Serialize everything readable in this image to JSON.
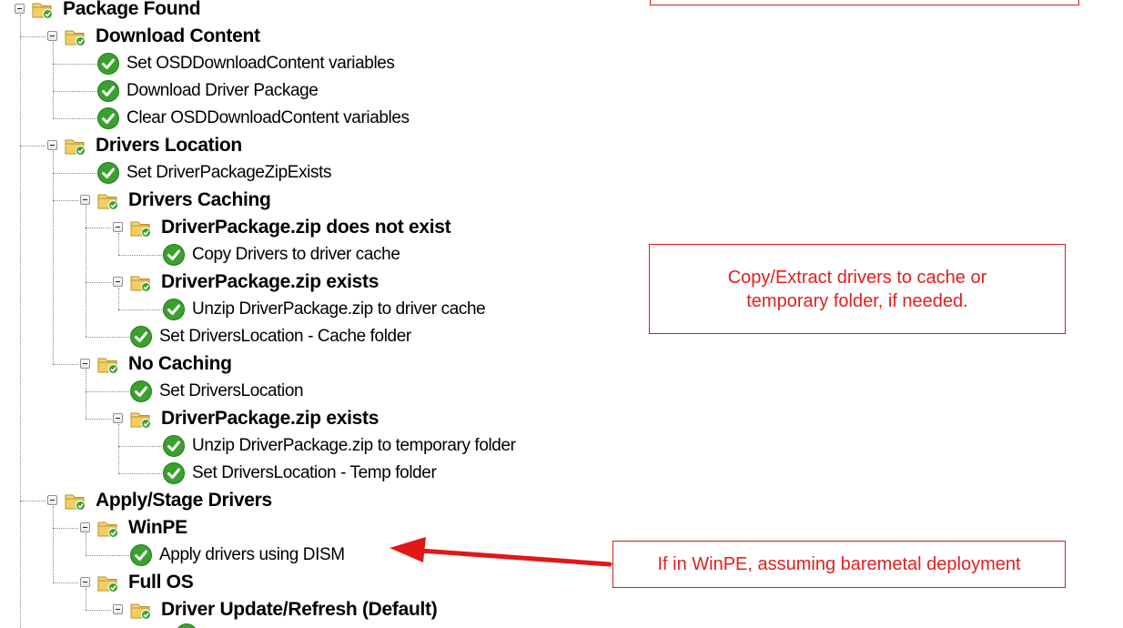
{
  "tree": {
    "nodes": [
      {
        "id": "package-found",
        "type": "group",
        "label": "Package Found"
      },
      {
        "id": "download-content",
        "type": "group",
        "label": "Download Content"
      },
      {
        "id": "set-osd-vars",
        "type": "step",
        "label": "Set OSDDownloadContent variables"
      },
      {
        "id": "download-driver-package",
        "type": "step",
        "label": "Download Driver Package"
      },
      {
        "id": "clear-osd-vars",
        "type": "step",
        "label": "Clear OSDDownloadContent variables"
      },
      {
        "id": "drivers-location",
        "type": "group",
        "label": "Drivers Location"
      },
      {
        "id": "set-zip-exists",
        "type": "step",
        "label": "Set DriverPackageZipExists"
      },
      {
        "id": "drivers-caching",
        "type": "group",
        "label": "Drivers Caching"
      },
      {
        "id": "zip-not-exist",
        "type": "group",
        "label": "DriverPackage.zip does not exist"
      },
      {
        "id": "copy-drivers-cache",
        "type": "step",
        "label": "Copy Drivers to driver cache"
      },
      {
        "id": "zip-exists-1",
        "type": "group",
        "label": "DriverPackage.zip exists"
      },
      {
        "id": "unzip-to-cache",
        "type": "step",
        "label": "Unzip DriverPackage.zip to driver cache"
      },
      {
        "id": "set-location-cache",
        "type": "step",
        "label": "Set DriversLocation - Cache folder"
      },
      {
        "id": "no-caching",
        "type": "group",
        "label": "No Caching"
      },
      {
        "id": "set-drivers-location",
        "type": "step",
        "label": "Set DriversLocation"
      },
      {
        "id": "zip-exists-2",
        "type": "group",
        "label": "DriverPackage.zip exists"
      },
      {
        "id": "unzip-to-temp",
        "type": "step",
        "label": "Unzip DriverPackage.zip to temporary folder"
      },
      {
        "id": "set-location-temp",
        "type": "step",
        "label": "Set DriversLocation - Temp folder"
      },
      {
        "id": "apply-stage-drivers",
        "type": "group",
        "label": "Apply/Stage Drivers"
      },
      {
        "id": "winpe",
        "type": "group",
        "label": "WinPE"
      },
      {
        "id": "apply-dism",
        "type": "step",
        "label": "Apply drivers using DISM"
      },
      {
        "id": "full-os",
        "type": "group",
        "label": "Full OS"
      },
      {
        "id": "driver-update-refresh",
        "type": "group",
        "label": "Driver Update/Refresh (Default)"
      }
    ]
  },
  "callouts": {
    "copy_extract": {
      "line1": "Copy/Extract drivers to cache or",
      "line2": "temporary folder, if needed."
    },
    "winpe": {
      "text": "If in WinPE, assuming baremetal deployment"
    }
  },
  "colors": {
    "callout_border": "#d02020",
    "callout_text": "#e0201c",
    "arrow": "#e01818",
    "check_green": "#3aa02e",
    "folder_yellow": "#e8c052"
  },
  "icons": {
    "group": "folder-check-icon",
    "step": "green-check-icon",
    "expander": "collapse-minus-icon"
  }
}
